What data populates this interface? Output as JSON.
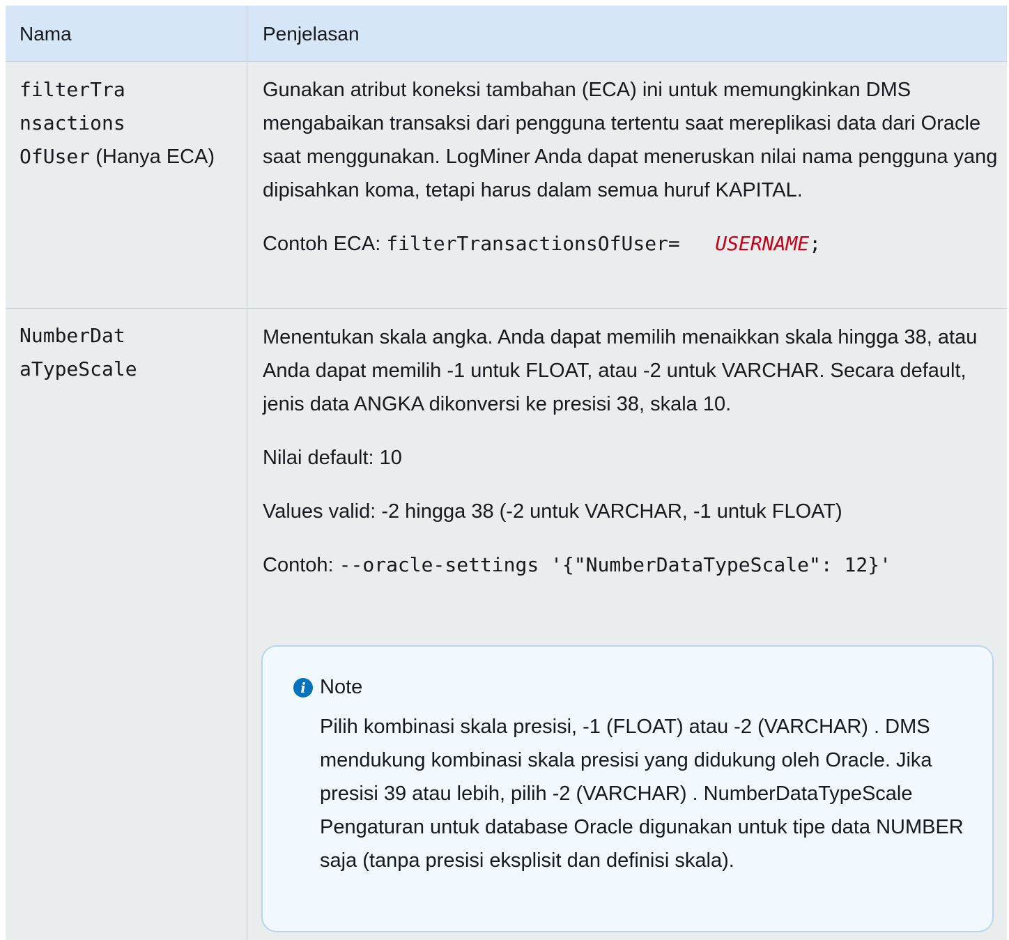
{
  "table": {
    "headers": [
      "Nama",
      "Penjelasan"
    ],
    "rows": [
      {
        "name_lines": [
          "filterTra",
          "nsactions",
          "OfUser"
        ],
        "name_suffix": " (Hanya ECA)",
        "paragraphs": [
          "Gunakan atribut koneksi tambahan (ECA) ini untuk memungkinkan DMS mengabaikan transaksi dari pengguna tertentu saat mereplikasi data dari Oracle saat menggunakan. LogMiner Anda dapat meneruskan nilai nama pengguna yang dipisahkan koma, tetapi harus dalam semua huruf KAPITAL."
        ],
        "example_label": "Contoh ECA: ",
        "example_code": "filterTransactionsOfUser=",
        "example_placeholder": "USERNAME",
        "example_end": ";"
      },
      {
        "name_lines": [
          "NumberDat",
          "aTypeScale"
        ],
        "paragraphs": [
          "Menentukan skala angka. Anda dapat memilih menaikkan skala hingga 38, atau Anda dapat memilih -1 untuk FLOAT, atau -2 untuk VARCHAR. Secara default, jenis data ANGKA dikonversi ke presisi 38, skala 10.",
          "Nilai default: 10",
          "Values valid: -2 hingga 38 (-2 untuk VARCHAR, -1 untuk FLOAT)"
        ],
        "example_label": "Contoh: ",
        "example_code": "--oracle-settings '{\"NumberDataTypeScale\": 12}'",
        "note": {
          "icon": "info-icon",
          "title": "Note",
          "body": "Pilih kombinasi skala presisi, -1 (FLOAT) atau -2 (VARCHAR) . DMS mendukung kombinasi skala presisi yang didukung oleh Oracle. Jika presisi 39 atau lebih, pilih -2 (VARCHAR) . NumberDataTypeScale Pengaturan untuk database Oracle digunakan untuk tipe data NUMBER saja (tanpa presisi eksplisit dan definisi skala)."
        }
      }
    ]
  }
}
